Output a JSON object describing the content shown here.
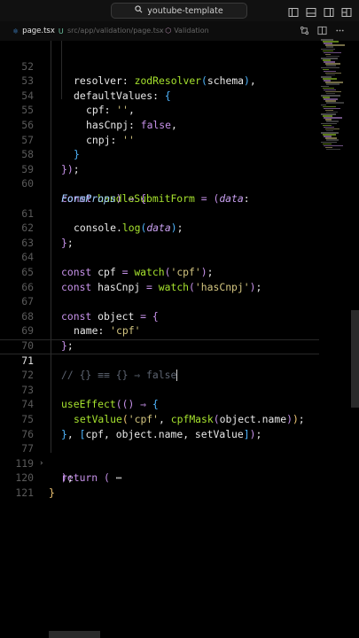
{
  "titlebar": {
    "search_text": "youtube-template"
  },
  "breadcrumb": {
    "file_name": "page.tsx",
    "file_status": "U",
    "path": "src/app/validation/page.tsx",
    "symbol": "Validation"
  },
  "editor": {
    "active_line": "71",
    "lines": [
      {
        "n": "52"
      },
      {
        "n": "53"
      },
      {
        "n": "54"
      },
      {
        "n": "55"
      },
      {
        "n": "56"
      },
      {
        "n": "57"
      },
      {
        "n": "58"
      },
      {
        "n": "59"
      },
      {
        "n": "60"
      },
      {
        "n": "61"
      },
      {
        "n": "62"
      },
      {
        "n": "63"
      },
      {
        "n": "64"
      },
      {
        "n": "65"
      },
      {
        "n": "66"
      },
      {
        "n": "67"
      },
      {
        "n": "68"
      },
      {
        "n": "69"
      },
      {
        "n": "70"
      },
      {
        "n": "71"
      },
      {
        "n": "72"
      },
      {
        "n": "73"
      },
      {
        "n": "74"
      },
      {
        "n": "75"
      },
      {
        "n": "76"
      },
      {
        "n": "77"
      },
      {
        "n": "119"
      },
      {
        "n": "120"
      },
      {
        "n": "121"
      }
    ],
    "code": {
      "l52": [
        "resolver",
        ": ",
        "zodResolver",
        "(",
        "schema",
        "),"
      ],
      "l53": [
        "defaultValues",
        ": ",
        "{"
      ],
      "l54": [
        "cpf",
        ": ",
        "''",
        ","
      ],
      "l55": [
        "hasCnpj",
        ": ",
        "false",
        ","
      ],
      "l56": [
        "cnpj",
        ": ",
        "''"
      ],
      "l57": [
        "}"
      ],
      "l58": [
        "})",
        ";"
      ],
      "l60": [
        "const ",
        "handleSubmitForm",
        " = ",
        "(",
        "data",
        ":"
      ],
      "l60b": [
        "FormProps",
        ")",
        " ⇒ ",
        "{"
      ],
      "l61": [
        "console",
        ".",
        "log",
        "(",
        "data",
        ");"
      ],
      "l62": [
        "};"
      ],
      "l64": [
        "const ",
        "cpf",
        " = ",
        "watch",
        "(",
        "'cpf'",
        ");"
      ],
      "l65": [
        "const ",
        "hasCnpj",
        " = ",
        "watch",
        "(",
        "'hasCnpj'",
        ");"
      ],
      "l67": [
        "const ",
        "object",
        " = ",
        "{"
      ],
      "l68": [
        "name",
        ": ",
        "'cpf'"
      ],
      "l69": [
        "};"
      ],
      "l71": [
        "// {} ≡≡ {} ⇒ false"
      ],
      "l73": [
        "useEffect",
        "((",
        ")",
        " ⇒ ",
        "{"
      ],
      "l74": [
        "setValue",
        "(",
        "'cpf'",
        ", ",
        "cpfMask",
        "(",
        "object",
        ".",
        "name",
        "));"
      ],
      "l75": [
        "}, ",
        "[",
        "cpf",
        ", ",
        "object",
        ".",
        "name",
        ", ",
        "setValue",
        "]",
        ");"
      ],
      "l77": [
        "return ",
        "(",
        " ⋯"
      ],
      "l119": [
        ")",
        ";"
      ],
      "l120": [
        "}"
      ]
    }
  },
  "colors": {
    "background": "#000000",
    "keyword": "#c792ea",
    "function": "#a6e22e",
    "string": "#d4c680",
    "comment": "#5c6370",
    "type": "#9ccafc"
  }
}
